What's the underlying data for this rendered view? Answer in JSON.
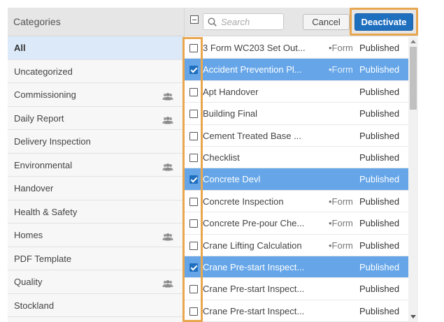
{
  "categories": {
    "header": "Categories",
    "items": [
      {
        "label": "All",
        "selected": true,
        "group_icon": false
      },
      {
        "label": "Uncategorized",
        "selected": false,
        "group_icon": false
      },
      {
        "label": "Commissioning",
        "selected": false,
        "group_icon": true
      },
      {
        "label": "Daily Report",
        "selected": false,
        "group_icon": true
      },
      {
        "label": "Delivery Inspection",
        "selected": false,
        "group_icon": false
      },
      {
        "label": "Environmental",
        "selected": false,
        "group_icon": true
      },
      {
        "label": "Handover",
        "selected": false,
        "group_icon": false
      },
      {
        "label": "Health & Safety",
        "selected": false,
        "group_icon": false
      },
      {
        "label": "Homes",
        "selected": false,
        "group_icon": true
      },
      {
        "label": "PDF Template",
        "selected": false,
        "group_icon": false
      },
      {
        "label": "Quality",
        "selected": false,
        "group_icon": true
      },
      {
        "label": "Stockland",
        "selected": false,
        "group_icon": false
      }
    ]
  },
  "toolbar": {
    "search_placeholder": "Search",
    "cancel_label": "Cancel",
    "deactivate_label": "Deactivate"
  },
  "forms": [
    {
      "name": "3 Form WC203 Set Out...",
      "type": "•Form",
      "status": "Published",
      "checked": false
    },
    {
      "name": "Accident Prevention Pl...",
      "type": "•Form",
      "status": "Published",
      "checked": true
    },
    {
      "name": "Apt Handover",
      "type": "",
      "status": "Published",
      "checked": false
    },
    {
      "name": "Building Final",
      "type": "",
      "status": "Published",
      "checked": false
    },
    {
      "name": "Cement Treated Base ...",
      "type": "",
      "status": "Published",
      "checked": false
    },
    {
      "name": "Checklist",
      "type": "",
      "status": "Published",
      "checked": false
    },
    {
      "name": "Concrete Devl",
      "type": "",
      "status": "Published",
      "checked": true
    },
    {
      "name": "Concrete Inspection",
      "type": "•Form",
      "status": "Published",
      "checked": false
    },
    {
      "name": "Concrete Pre-pour Che...",
      "type": "•Form",
      "status": "Published",
      "checked": false
    },
    {
      "name": "Crane Lifting Calculation",
      "type": "•Form",
      "status": "Published",
      "checked": false
    },
    {
      "name": "Crane Pre-start Inspect...",
      "type": "",
      "status": "Published",
      "checked": true
    },
    {
      "name": "Crane Pre-start Inspect...",
      "type": "",
      "status": "Published",
      "checked": false
    },
    {
      "name": "Crane Pre-start Inspect...",
      "type": "",
      "status": "Published",
      "checked": false
    }
  ],
  "colors": {
    "accent": "#1f6fbf",
    "selected_row": "#66a6e8",
    "highlight_outline": "#e8a74f",
    "selected_category": "#dbe9f8"
  },
  "icons": {
    "search": "search-icon",
    "group": "group-icon",
    "select_all": "select-all-checkbox"
  }
}
